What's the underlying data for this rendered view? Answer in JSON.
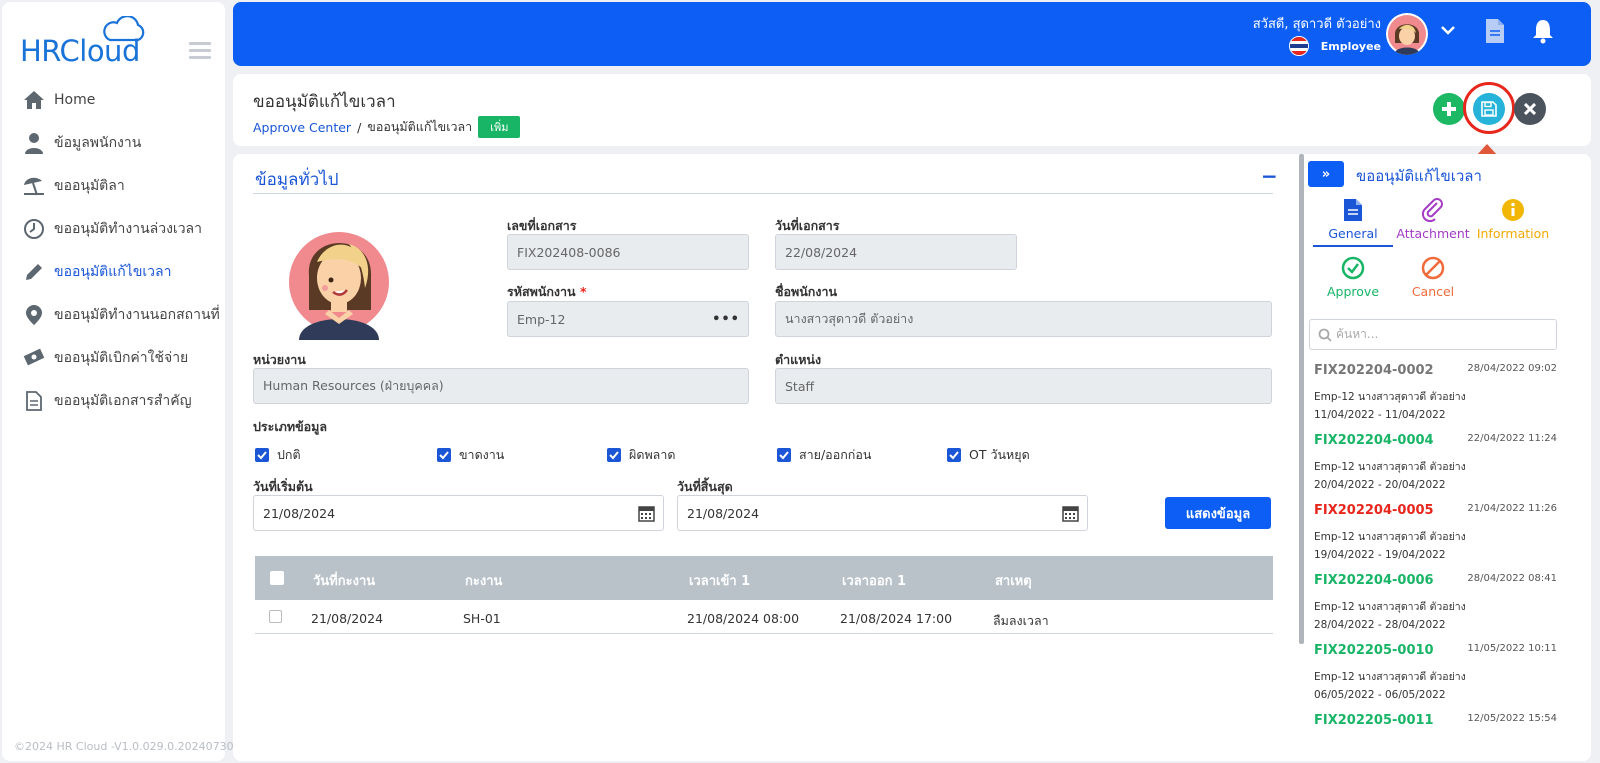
{
  "brand": {
    "logo_text": "HRCloud",
    "version": "©2024 HR Cloud -V1.0.029.0.20240730"
  },
  "sidebar": {
    "items": [
      {
        "label": "Home",
        "icon": "home-icon"
      },
      {
        "label": "ข้อมูลพนักงาน",
        "icon": "user-icon"
      },
      {
        "label": "ขออนุมัติลา",
        "icon": "beach-umbrella-icon"
      },
      {
        "label": "ขออนุมัติทำงานล่วงเวลา",
        "icon": "clock-icon"
      },
      {
        "label": "ขออนุมัติแก้ไขเวลา",
        "icon": "pencil-icon",
        "active": true
      },
      {
        "label": "ขออนุมัติทำงานนอกสถานที่",
        "icon": "map-marker-icon"
      },
      {
        "label": "ขออนุมัติเบิกค่าใช้จ่าย",
        "icon": "money-icon"
      },
      {
        "label": "ขออนุมัติเอกสารสำคัญ",
        "icon": "document-icon"
      }
    ]
  },
  "header": {
    "greeting": "สวัสดี, สุดาวดี ตัวอย่าง",
    "role": "Employee"
  },
  "page": {
    "title": "ขออนุมัติแก้ไขเวลา",
    "breadcrumb_link": "Approve Center",
    "breadcrumb_separator": "/",
    "breadcrumb_current": "ขออนุมัติแก้ไขเวลา",
    "mode_badge": "เพิ่ม"
  },
  "form": {
    "section_title": "ข้อมูลทั่วไป",
    "doc_no_label": "เลขที่เอกสาร",
    "doc_no_value": "FIX202408-0086",
    "doc_date_label": "วันที่เอกสาร",
    "doc_date_value": "22/08/2024",
    "emp_code_label": "รหัสพนักงาน",
    "emp_code_value": "Emp-12",
    "emp_name_label": "ชื่อพนักงาน",
    "emp_name_value": "นางสาวสุดาวดี  ตัวอย่าง",
    "dept_label": "หน่วยงาน",
    "dept_value": "Human Resources (ฝ่ายบุคคล)",
    "position_label": "ตำแหน่ง",
    "position_value": "Staff",
    "type_label": "ประเภทข้อมูล",
    "types": [
      "ปกติ",
      "ขาดงาน",
      "ผิดพลาด",
      "สาย/ออกก่อน",
      "OT วันหยุด"
    ],
    "start_label": "วันที่เริ่มต้น",
    "start_value": "21/08/2024",
    "end_label": "วันที่สิ้นสุด",
    "end_value": "21/08/2024",
    "show_button": "แสดงข้อมูล"
  },
  "table": {
    "columns": [
      "วันที่กะงาน",
      "กะงาน",
      "เวลาเข้า 1",
      "เวลาออก 1",
      "สาเหตุ"
    ],
    "rows": [
      {
        "date": "21/08/2024",
        "shift": "SH-01",
        "in": "21/08/2024 08:00",
        "out": "21/08/2024 17:00",
        "reason": "ลืมลงเวลา"
      }
    ]
  },
  "right_panel": {
    "title": "ขออนุมัติแก้ไขเวลา",
    "tabs": [
      "General",
      "Attachment",
      "Information",
      "Approve",
      "Cancel"
    ],
    "search_placeholder": "ค้นหา...",
    "items": [
      {
        "code": "FIX202204-0002",
        "datetime": "28/04/2022 09:02",
        "emp": "Emp-12 นางสาวสุดาวดี ตัวอย่าง",
        "range": "11/04/2022 - 11/04/2022",
        "color": "#777777"
      },
      {
        "code": "FIX202204-0004",
        "datetime": "22/04/2022 11:24",
        "emp": "Emp-12 นางสาวสุดาวดี ตัวอย่าง",
        "range": "20/04/2022 - 20/04/2022",
        "color": "#18b566"
      },
      {
        "code": "FIX202204-0005",
        "datetime": "21/04/2022 11:26",
        "emp": "Emp-12 นางสาวสุดาวดี ตัวอย่าง",
        "range": "19/04/2022 - 19/04/2022",
        "color": "#e8261c"
      },
      {
        "code": "FIX202204-0006",
        "datetime": "28/04/2022 08:41",
        "emp": "Emp-12 นางสาวสุดาวดี ตัวอย่าง",
        "range": "28/04/2022 - 28/04/2022",
        "color": "#18b566"
      },
      {
        "code": "FIX202205-0010",
        "datetime": "11/05/2022 10:11",
        "emp": "Emp-12 นางสาวสุดาวดี ตัวอย่าง",
        "range": "06/05/2022 - 06/05/2022",
        "color": "#18b566"
      },
      {
        "code": "FIX202205-0011",
        "datetime": "12/05/2022 15:54",
        "emp": "",
        "range": "",
        "color": "#18b566"
      }
    ]
  },
  "colors": {
    "primary": "#0d5ef5",
    "success": "#18b566",
    "danger": "#e8261c",
    "info": "#25b3d9"
  }
}
